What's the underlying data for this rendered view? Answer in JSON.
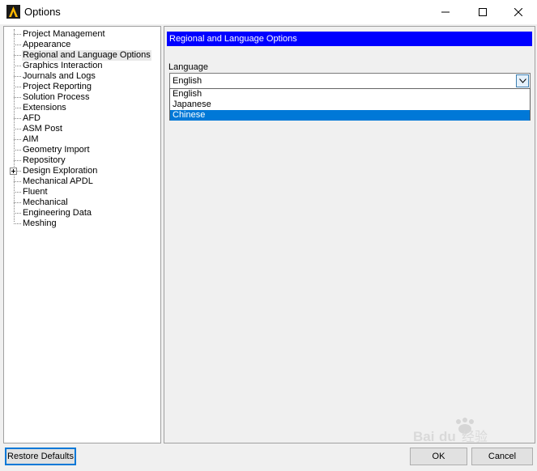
{
  "window": {
    "title": "Options",
    "icon": "ansys-logo-icon"
  },
  "tree": {
    "items": [
      {
        "label": "Project Management"
      },
      {
        "label": "Appearance"
      },
      {
        "label": "Regional and Language Options",
        "selected": true
      },
      {
        "label": "Graphics Interaction"
      },
      {
        "label": "Journals and Logs"
      },
      {
        "label": "Project Reporting"
      },
      {
        "label": "Solution Process"
      },
      {
        "label": "Extensions"
      },
      {
        "label": "AFD"
      },
      {
        "label": "ASM Post"
      },
      {
        "label": "AIM"
      },
      {
        "label": "Geometry Import"
      },
      {
        "label": "Repository"
      },
      {
        "label": "Design Exploration",
        "expandable": true
      },
      {
        "label": "Mechanical APDL"
      },
      {
        "label": "Fluent"
      },
      {
        "label": "Mechanical"
      },
      {
        "label": "Engineering Data"
      },
      {
        "label": "Meshing"
      }
    ]
  },
  "panel": {
    "header": "Regional and Language Options",
    "language_label": "Language",
    "language_value": "English",
    "language_options": [
      "English",
      "Japanese",
      "Chinese"
    ],
    "highlighted_option": "Chinese"
  },
  "buttons": {
    "restore_defaults": "Restore Defaults",
    "ok": "OK",
    "cancel": "Cancel"
  },
  "colors": {
    "header_bg": "#0000ff",
    "highlight": "#0078d7",
    "focus_border": "#0078d7",
    "logo_yellow": "#ffb900"
  }
}
